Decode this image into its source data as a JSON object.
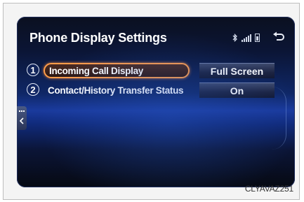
{
  "screen": {
    "title": "Phone Display Settings",
    "rows": [
      {
        "number": "1",
        "label": "Incoming Call Display",
        "value": "Full Screen",
        "selected": true
      },
      {
        "number": "2",
        "label": "Contact/History Transfer Status",
        "value": "On",
        "selected": false
      }
    ],
    "status_icons": [
      "bluetooth-icon",
      "signal-icon",
      "battery-icon"
    ],
    "back_icon": "back-arrow-icon"
  },
  "caption": {
    "code": "CLYAVAZ251"
  },
  "colors": {
    "highlight": "#ff9d4a",
    "background": "#0f2766"
  }
}
